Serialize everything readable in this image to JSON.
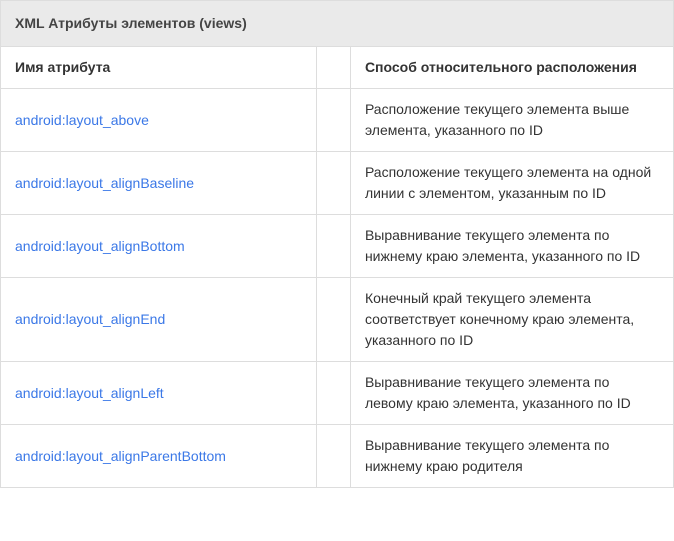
{
  "table": {
    "title": "XML Атрибуты элементов (views)",
    "headers": {
      "attribute": "Имя атрибута",
      "method": "Способ относительного расположения"
    },
    "rows": [
      {
        "attr": "android:layout_above",
        "desc": "Расположение текущего элемента выше элемента, указанного по ID"
      },
      {
        "attr": "android:layout_alignBaseline",
        "desc": "Расположение текущего элемента на одной линии с элементом, указанным по ID"
      },
      {
        "attr": "android:layout_alignBottom",
        "desc": "Выравнивание текущего элемента по нижнему краю элемента, указанного по ID"
      },
      {
        "attr": "android:layout_alignEnd",
        "desc": "Конечный край текущего элемента соответствует конечному краю элемента, указанного по ID"
      },
      {
        "attr": "android:layout_alignLeft",
        "desc": "Выравнивание текущего элемента по левому краю элемента, указанного по ID"
      },
      {
        "attr": "android:layout_alignParentBottom",
        "desc": "Выравнивание текущего элемента по нижнему краю родителя"
      }
    ]
  }
}
